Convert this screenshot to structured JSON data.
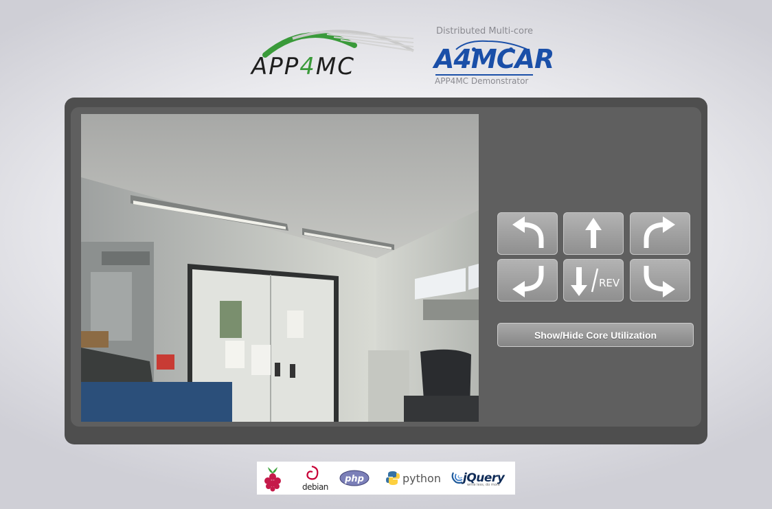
{
  "header": {
    "app4mc_logo": {
      "prefix": "APP",
      "digit": "4",
      "suffix": "MC"
    },
    "a4mcar_logo": {
      "top": "Distributed Multi-core",
      "prefix": "A",
      "digit": "4",
      "suffix": "MCAR",
      "bottom": "APP4MC Demonstrator"
    }
  },
  "controls": {
    "directions": [
      {
        "name": "forward-left",
        "icon": "turn-left-icon"
      },
      {
        "name": "forward",
        "icon": "arrow-up-icon"
      },
      {
        "name": "forward-right",
        "icon": "turn-right-icon"
      },
      {
        "name": "backward-left",
        "icon": "reverse-left-icon"
      },
      {
        "name": "backward",
        "icon": "arrow-down-icon",
        "label": "REV"
      },
      {
        "name": "backward-right",
        "icon": "reverse-right-icon"
      }
    ],
    "core_button_label": "Show/Hide Core Utilization"
  },
  "footer": {
    "logos": [
      {
        "name": "raspberry-pi",
        "icon": "raspberry-pi-icon"
      },
      {
        "name": "debian",
        "label": "debian",
        "icon": "debian-swirl-icon"
      },
      {
        "name": "php",
        "label": "php",
        "icon": "php-oval-icon"
      },
      {
        "name": "python",
        "label": "python",
        "icon": "python-snakes-icon"
      },
      {
        "name": "jquery",
        "label": "jQuery",
        "tagline": "write less, do more",
        "icon": "jquery-waves-icon"
      }
    ]
  },
  "colors": {
    "panel_outer": "#4e4e4e",
    "panel_inner": "#5f5f5f",
    "button": "#9f9f9f",
    "app4mc_green": "#3a9a3a",
    "a4mcar_blue": "#1a4fa8"
  }
}
